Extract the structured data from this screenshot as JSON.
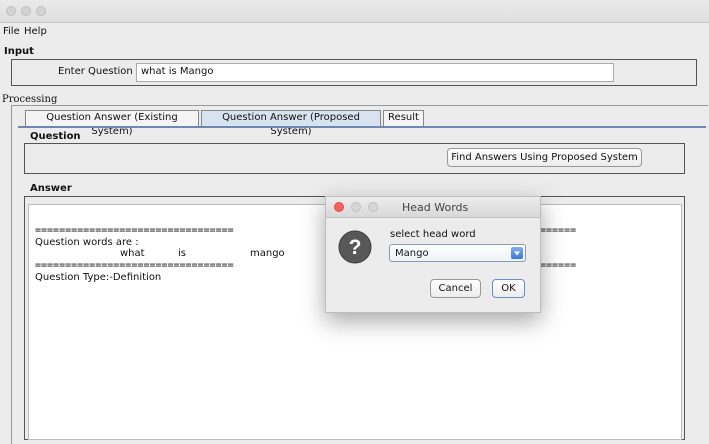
{
  "menu": [
    "File",
    "Help"
  ],
  "input": {
    "group_label": "Input",
    "question_label": "Enter Question",
    "question_value": "what is Mango"
  },
  "processing": {
    "label": "Processing",
    "tabs": [
      {
        "label": "Question Answer (Existing System)",
        "active": false
      },
      {
        "label": "Question Answer (Proposed System)",
        "active": true
      },
      {
        "label": "Result",
        "active": false
      }
    ],
    "question_group_label": "Question",
    "find_button": "Find Answers Using Proposed System",
    "answer_group_label": "Answer",
    "answer_lines": {
      "separator": "=================================",
      "separator_right": "======",
      "words_header": "Question words are :",
      "word1": "what",
      "word2": "is",
      "word3": "mango",
      "separator2": "=================================",
      "separator2_right": "======",
      "type_line": "Question Type:-Definition"
    }
  },
  "dialog": {
    "title": "Head Words",
    "prompt": "select head word",
    "selected": "Mango",
    "cancel": "Cancel",
    "ok": "OK",
    "icon": "question-icon"
  },
  "colors": {
    "active_tab": "#d7e3f0",
    "close_button": "#fc605c",
    "question_icon": "#585858"
  }
}
